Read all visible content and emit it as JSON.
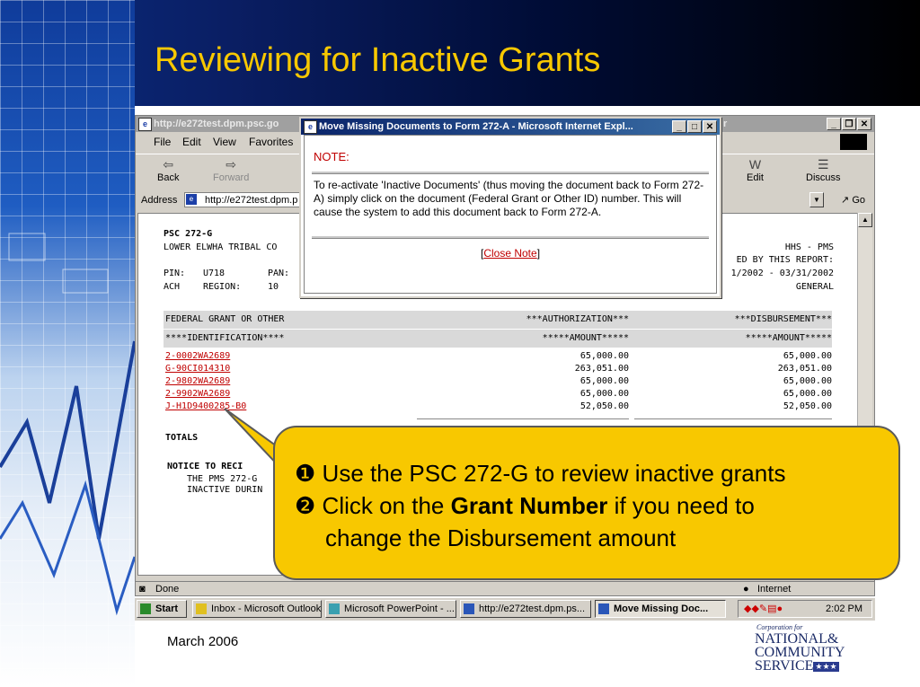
{
  "slide": {
    "title": "Reviewing for Inactive Grants",
    "footer_date": "March 2006"
  },
  "browser": {
    "title": "http://e272test.dpm.psc.go",
    "title_suffix": "r",
    "menu": [
      "File",
      "Edit",
      "View",
      "Favorites"
    ],
    "toolbar": {
      "back": "Back",
      "forward": "Forward",
      "edit": "Edit",
      "discuss": "Discuss"
    },
    "address_label": "Address",
    "address_value": "http://e272test.dpm.p",
    "go_label": "Go",
    "status": "Done",
    "zone": "Internet"
  },
  "report": {
    "form_name": "PSC 272-G",
    "org_name": "LOWER ELWHA TRIBAL CO",
    "agency": "HHS - PMS",
    "covered_label": "ED BY THIS REPORT:",
    "pin_label": "PIN:",
    "pin_value": "U718",
    "pan_label": "PAN:",
    "period": "1/2002 - 03/31/2002",
    "ach_label": "ACH",
    "region_label": "REGION:",
    "region_value": "10",
    "account_type": "GENERAL",
    "headers": {
      "col1_line1": "FEDERAL GRANT OR OTHER",
      "col1_line2": "****IDENTIFICATION****",
      "col2_line1": "***AUTHORIZATION***",
      "col2_line2": "*****AMOUNT*****",
      "col3_line1": "***DISBURSEMENT***",
      "col3_line2": "*****AMOUNT*****"
    },
    "rows": [
      {
        "id": "2-0002WA2689",
        "auth": "65,000.00",
        "disb": "65,000.00"
      },
      {
        "id": "G-90CI014310",
        "auth": "263,051.00",
        "disb": "263,051.00"
      },
      {
        "id": "2-9802WA2689",
        "auth": "65,000.00",
        "disb": "65,000.00"
      },
      {
        "id": "2-9902WA2689",
        "auth": "65,000.00",
        "disb": "65,000.00"
      },
      {
        "id": "J-H1D9400285-B0",
        "auth": "52,050.00",
        "disb": "52,050.00"
      }
    ],
    "totals_label": "TOTALS",
    "notice_label": "NOTICE TO RECI",
    "notice_line1": "THE PMS 272-G",
    "notice_line2": "INACTIVE DURIN"
  },
  "popup": {
    "title": "Move Missing Documents to Form 272-A - Microsoft Internet Expl...",
    "note_heading": "NOTE:",
    "note_text": "To re-activate 'Inactive Documents' (thus moving the document back to Form 272-A) simply click on the document (Federal Grant or Other ID) number. This will cause the system to add this document back to Form 272-A.",
    "close_label": "Close Note"
  },
  "taskbar": {
    "start": "Start",
    "items": [
      "Inbox - Microsoft Outlook",
      "Microsoft PowerPoint - ...",
      "http://e272test.dpm.ps...",
      "Move Missing Doc..."
    ],
    "clock": "2:02 PM"
  },
  "callout": {
    "bullet1_marker": "❶",
    "bullet1": "Use the PSC 272-G to review inactive grants",
    "bullet2_marker": "❷",
    "bullet2_prefix": "Click on the",
    "bullet2_bold": "Grant Number",
    "bullet2_suffix": "if you need to",
    "bullet2_line2": "change the Disbursement amount"
  },
  "logo": {
    "small": "Corporation for",
    "line1": "NATIONAL",
    "amp": "&",
    "line2": "COMMUNITY",
    "line3": "SERVICE",
    "stars": "★★★"
  },
  "colors": {
    "title": "#f8c800",
    "callout_bg": "#f8c800",
    "link": "#c00000"
  }
}
